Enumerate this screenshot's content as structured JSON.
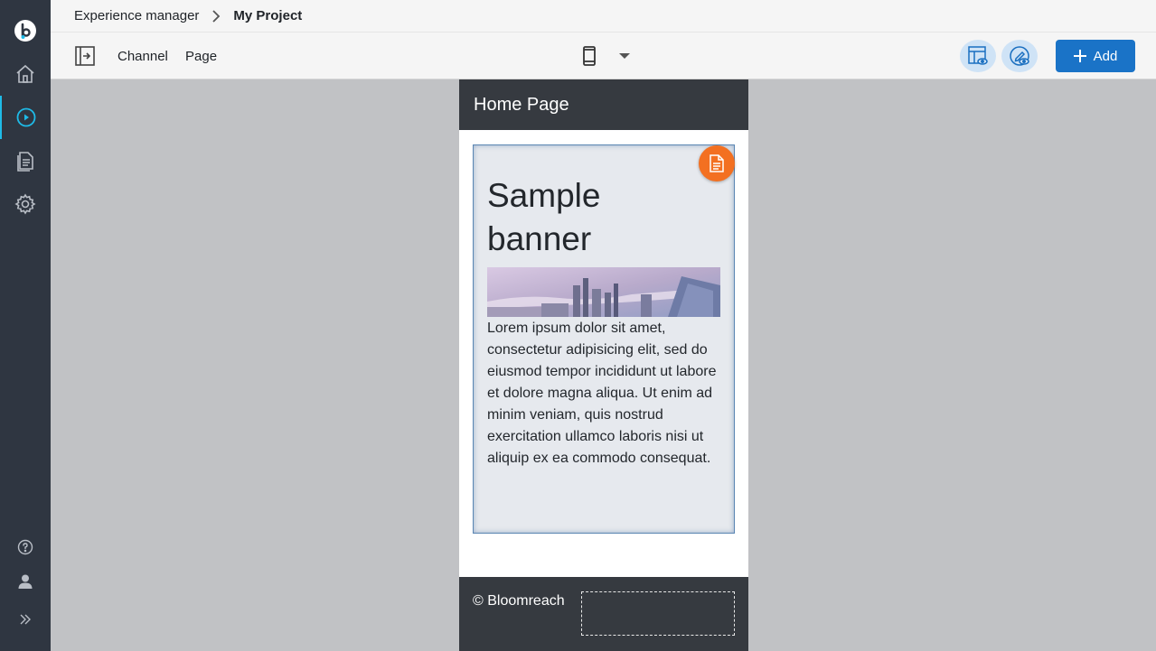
{
  "nav": {
    "items": [
      {
        "name": "logo-icon"
      },
      {
        "name": "home-icon"
      },
      {
        "name": "experience-manager-icon",
        "active": true
      },
      {
        "name": "content-icon"
      },
      {
        "name": "settings-icon"
      }
    ],
    "bottom": [
      {
        "name": "help-icon"
      },
      {
        "name": "user-icon"
      },
      {
        "name": "expand-icon"
      }
    ]
  },
  "breadcrumb": {
    "app": "Experience manager",
    "current": "My Project"
  },
  "toolbar": {
    "channel_label": "Channel",
    "page_label": "Page",
    "device": "mobile-device-icon",
    "add_label": "Add"
  },
  "preview": {
    "page_title": "Home Page",
    "banner": {
      "title": "Sample banner",
      "body": "Lorem ipsum dolor sit amet, consectetur adipisicing elit, sed do eiusmod tempor incididunt ut labore et dolore magna aliqua. Ut enim ad minim veniam, quis nostrud exercitation ullamco laboris nisi ut aliquip ex ea commodo consequat."
    },
    "footer_text": "© Bloomreach"
  },
  "colors": {
    "rail": "#2f3641",
    "accent": "#1ebbe8",
    "primary_button": "#1a73c7",
    "badge": "#f37021",
    "header_footer": "#363a40"
  }
}
